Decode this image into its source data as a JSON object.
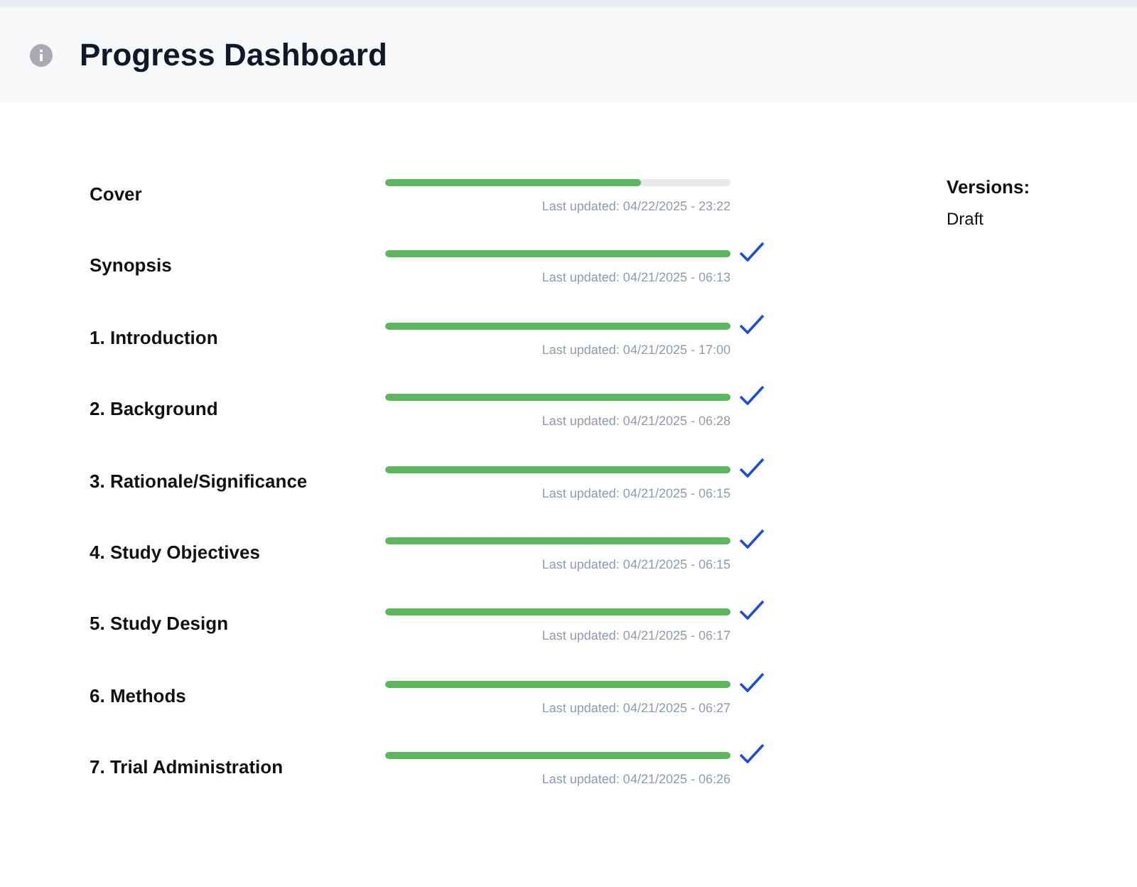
{
  "header": {
    "title": "Progress Dashboard"
  },
  "sections": [
    {
      "label": "Cover",
      "level": 0.74,
      "updated": "Last updated: 04/22/2025 - 23:22",
      "complete": false
    },
    {
      "label": "Synopsis",
      "level": 1,
      "updated": "Last updated: 04/21/2025 - 06:13",
      "complete": true
    },
    {
      "label": "1. Introduction",
      "level": 1,
      "updated": "Last updated: 04/21/2025 - 17:00",
      "complete": true
    },
    {
      "label": "2. Background",
      "level": 1,
      "updated": "Last updated: 04/21/2025 - 06:28",
      "complete": true
    },
    {
      "label": "3. Rationale/Significance",
      "level": 1,
      "updated": "Last updated: 04/21/2025 - 06:15",
      "complete": true
    },
    {
      "label": "4. Study Objectives",
      "level": 1,
      "updated": "Last updated: 04/21/2025 - 06:15",
      "complete": true
    },
    {
      "label": "5. Study Design",
      "level": 1,
      "updated": "Last updated: 04/21/2025 - 06:17",
      "complete": true
    },
    {
      "label": "6. Methods",
      "level": 1,
      "updated": "Last updated: 04/21/2025 - 06:27",
      "complete": true
    },
    {
      "label": "7. Trial Administration",
      "level": 1,
      "updated": "Last updated: 04/21/2025 - 06:26",
      "complete": true
    }
  ],
  "versions": {
    "heading": "Versions:",
    "items": [
      "Draft"
    ]
  }
}
